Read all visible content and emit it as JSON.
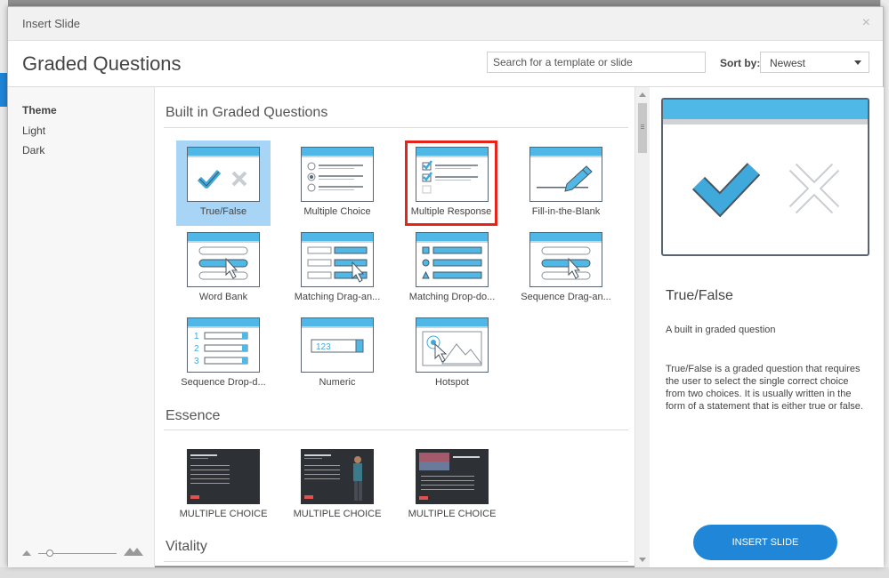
{
  "dialog": {
    "title": "Insert Slide",
    "close_glyph": "×",
    "heading": "Graded Questions"
  },
  "search": {
    "placeholder": "Search for a template or slide"
  },
  "sort": {
    "label": "Sort by:",
    "value": "Newest"
  },
  "sidebar": {
    "heading": "Theme",
    "items": [
      {
        "label": "Light"
      },
      {
        "label": "Dark"
      }
    ]
  },
  "sections": [
    {
      "title": "Built in Graded Questions"
    },
    {
      "title": "Essence"
    },
    {
      "title": "Vitality"
    }
  ],
  "tiles": [
    {
      "label": "True/False",
      "icon": "true-false-icon",
      "selected": true
    },
    {
      "label": "Multiple Choice",
      "icon": "multiple-choice-icon"
    },
    {
      "label": "Multiple Response",
      "icon": "multiple-response-icon",
      "highlighted": true
    },
    {
      "label": "Fill-in-the-Blank",
      "icon": "fill-in-blank-icon"
    },
    {
      "label": "Word Bank",
      "icon": "word-bank-icon"
    },
    {
      "label": "Matching  Drag-an...",
      "icon": "matching-drag-icon"
    },
    {
      "label": "Matching  Drop-do...",
      "icon": "matching-drop-icon"
    },
    {
      "label": "Sequence  Drag-an...",
      "icon": "sequence-drag-icon"
    },
    {
      "label": "Sequence  Drop-d...",
      "icon": "sequence-drop-icon"
    },
    {
      "label": "Numeric",
      "icon": "numeric-icon",
      "thumb_text": "123"
    },
    {
      "label": "Hotspot",
      "icon": "hotspot-icon"
    }
  ],
  "essence_tiles": [
    {
      "label": "MULTIPLE CHOICE"
    },
    {
      "label": "MULTIPLE CHOICE"
    },
    {
      "label": "MULTIPLE CHOICE"
    }
  ],
  "preview": {
    "title": "True/False",
    "subtitle": "A built in graded question",
    "description": "True/False is a graded question that requires the user to select the single correct choice from two choices.  It is usually written in the form of a statement that is either true or false."
  },
  "insert_button": {
    "label": "INSERT SLIDE"
  },
  "colors": {
    "accent": "#1f86d8",
    "thumb_header": "#4fb8e6",
    "selected_tile": "#a8d4f5",
    "highlight": "#e5251b"
  }
}
